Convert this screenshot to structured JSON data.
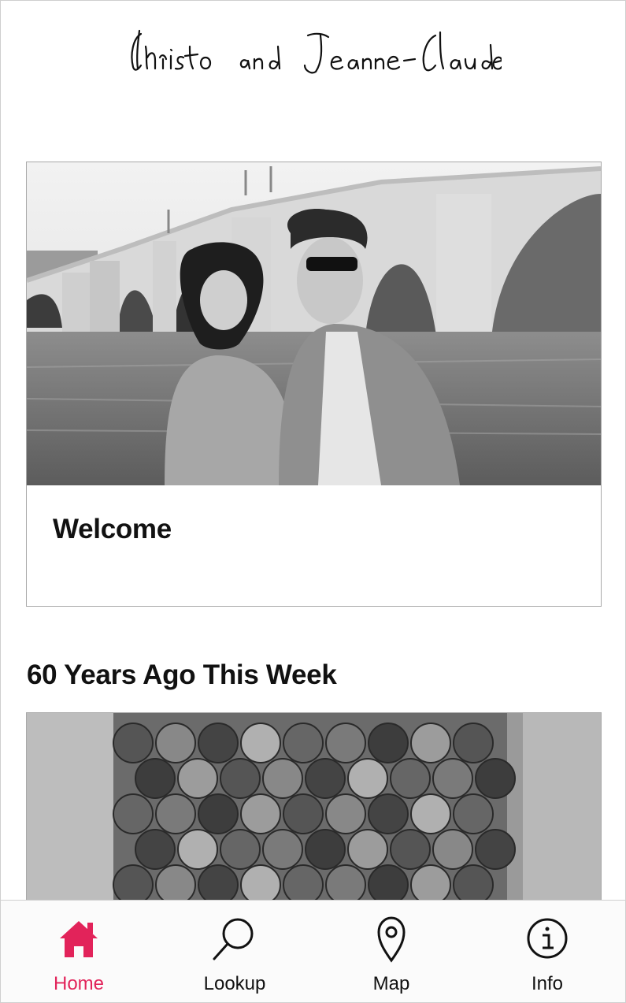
{
  "app": {
    "logo_text": "Christo and Jeanne-Claude"
  },
  "featured": {
    "title": "Welcome"
  },
  "section": {
    "title": "60 Years Ago This Week"
  },
  "tabbar": {
    "tabs": [
      {
        "label": "Home",
        "icon": "home-icon",
        "active": true
      },
      {
        "label": "Lookup",
        "icon": "search-icon",
        "active": false
      },
      {
        "label": "Map",
        "icon": "map-pin-icon",
        "active": false
      },
      {
        "label": "Info",
        "icon": "info-icon",
        "active": false
      }
    ]
  },
  "colors": {
    "accent": "#e2235a",
    "text": "#111111",
    "border": "#a9a9a9"
  }
}
